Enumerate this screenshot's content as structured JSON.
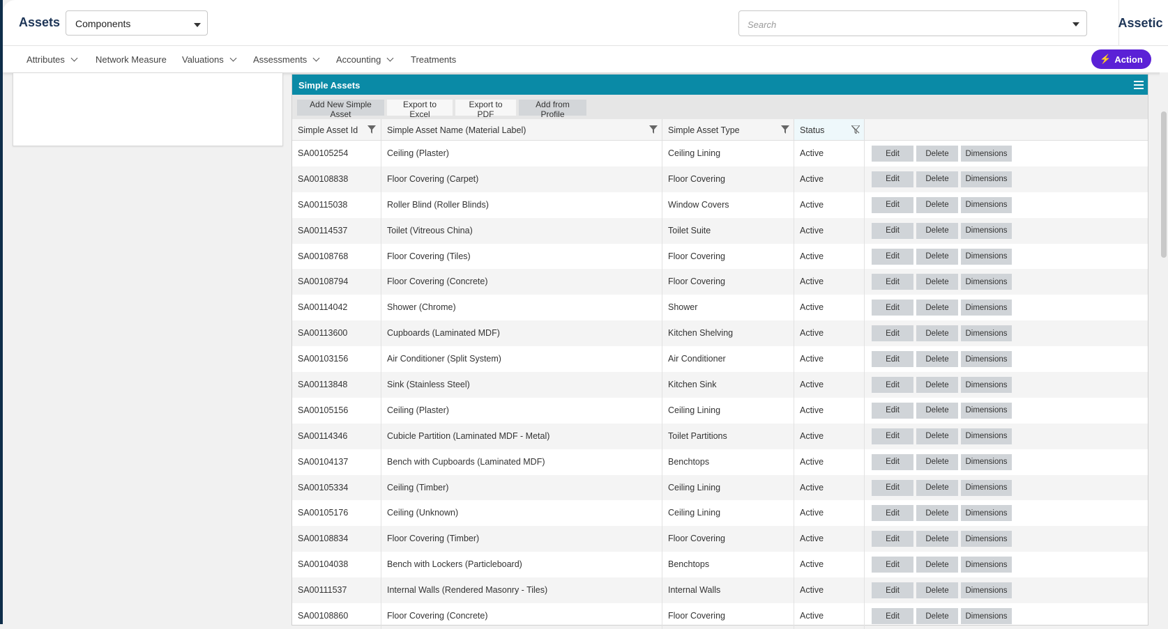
{
  "header": {
    "brand": "Assets",
    "context_select_value": "Components",
    "search_placeholder": "Search",
    "product_name": "Assetic"
  },
  "nav": {
    "items": [
      {
        "label": "Attributes",
        "has_dropdown": true
      },
      {
        "label": "Network Measure",
        "has_dropdown": false
      },
      {
        "label": "Valuations",
        "has_dropdown": true
      },
      {
        "label": "Assessments",
        "has_dropdown": true
      },
      {
        "label": "Accounting",
        "has_dropdown": true
      },
      {
        "label": "Treatments",
        "has_dropdown": false
      }
    ],
    "action_label": "Action"
  },
  "grid": {
    "title": "Simple Assets",
    "toolbar": {
      "add_new": "Add New Simple Asset",
      "export_excel": "Export to Excel",
      "export_pdf": "Export to PDF",
      "add_from_profile": "Add from Profile"
    },
    "columns": [
      "Simple Asset Id",
      "Simple Asset Name (Material Label)",
      "Simple Asset Type",
      "Status"
    ],
    "row_actions": {
      "edit": "Edit",
      "delete": "Delete",
      "dimensions": "Dimensions"
    },
    "rows": [
      {
        "id": "SA00105254",
        "name": "Ceiling (Plaster)",
        "type": "Ceiling Lining",
        "status": "Active"
      },
      {
        "id": "SA00108838",
        "name": "Floor Covering (Carpet)",
        "type": "Floor Covering",
        "status": "Active"
      },
      {
        "id": "SA00115038",
        "name": "Roller Blind (Roller Blinds)",
        "type": "Window Covers",
        "status": "Active"
      },
      {
        "id": "SA00114537",
        "name": "Toilet (Vitreous China)",
        "type": "Toilet Suite",
        "status": "Active"
      },
      {
        "id": "SA00108768",
        "name": "Floor Covering (Tiles)",
        "type": "Floor Covering",
        "status": "Active"
      },
      {
        "id": "SA00108794",
        "name": "Floor Covering (Concrete)",
        "type": "Floor Covering",
        "status": "Active"
      },
      {
        "id": "SA00114042",
        "name": "Shower (Chrome)",
        "type": "Shower",
        "status": "Active"
      },
      {
        "id": "SA00113600",
        "name": "Cupboards (Laminated MDF)",
        "type": "Kitchen Shelving",
        "status": "Active"
      },
      {
        "id": "SA00103156",
        "name": "Air Conditioner (Split System)",
        "type": "Air Conditioner",
        "status": "Active"
      },
      {
        "id": "SA00113848",
        "name": "Sink (Stainless Steel)",
        "type": "Kitchen Sink",
        "status": "Active"
      },
      {
        "id": "SA00105156",
        "name": "Ceiling (Plaster)",
        "type": "Ceiling Lining",
        "status": "Active"
      },
      {
        "id": "SA00114346",
        "name": "Cubicle Partition (Laminated MDF - Metal)",
        "type": "Toilet Partitions",
        "status": "Active"
      },
      {
        "id": "SA00104137",
        "name": "Bench with Cupboards (Laminated MDF)",
        "type": "Benchtops",
        "status": "Active"
      },
      {
        "id": "SA00105334",
        "name": "Ceiling (Timber)",
        "type": "Ceiling Lining",
        "status": "Active"
      },
      {
        "id": "SA00105176",
        "name": "Ceiling (Unknown)",
        "type": "Ceiling Lining",
        "status": "Active"
      },
      {
        "id": "SA00108834",
        "name": "Floor Covering (Timber)",
        "type": "Floor Covering",
        "status": "Active"
      },
      {
        "id": "SA00104038",
        "name": "Bench with Lockers (Particleboard)",
        "type": "Benchtops",
        "status": "Active"
      },
      {
        "id": "SA00111537",
        "name": "Internal Walls (Rendered Masonry - Tiles)",
        "type": "Internal Walls",
        "status": "Active"
      },
      {
        "id": "SA00108860",
        "name": "Floor Covering (Concrete)",
        "type": "Floor Covering",
        "status": "Active"
      }
    ]
  },
  "colors": {
    "brand_text": "#1d3557",
    "grid_title_bg": "#0a8aa6",
    "action_button": "#5b21d6"
  }
}
